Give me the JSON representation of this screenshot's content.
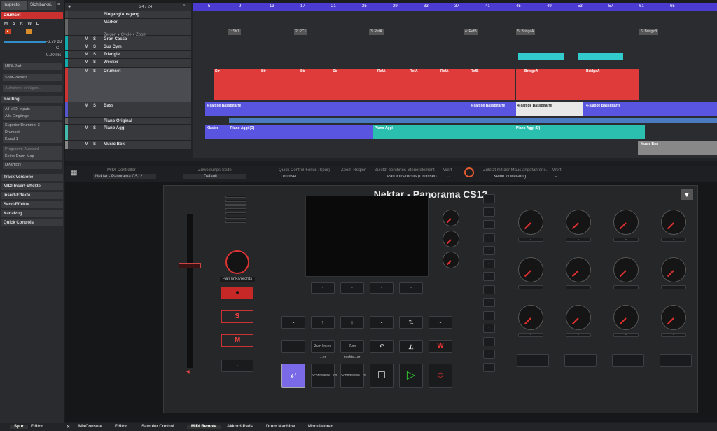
{
  "inspector": {
    "tab1": "Inspecto.",
    "tab2": "Sichtbarkei.",
    "track_name": "Drumset",
    "volume": "-6.79 dB",
    "pan": "C",
    "delay": "0.00 ms",
    "midi_part": "MIDI-Part",
    "preset": "Spur-Presets...",
    "notes": "Aufnahme einfügen...",
    "routing": "Routing",
    "input": "All MIDI Inputs",
    "input2": "Alle Eingänge",
    "instrument": "Superior Drummer 3",
    "output": "Drumset",
    "channel": "Kanal 1",
    "program": "Programm-Auswahl",
    "map": "Keine Drum-Map",
    "master": "MASTER",
    "sections": [
      "Track Versione",
      "MIDI-Insert-Effekte",
      "Insert-Effekte",
      "Send-Effekte",
      "Kanalzug",
      "Quick Controls"
    ]
  },
  "arranger": {
    "counter": "24 / 24",
    "ruler": [
      "5",
      "9",
      "13",
      "17",
      "21",
      "25",
      "29",
      "33",
      "37",
      "41",
      "45",
      "49",
      "53",
      "57",
      "61",
      "65"
    ],
    "tracks": [
      {
        "name": "Eingang/Ausgang"
      },
      {
        "name": "Marker"
      },
      {
        "name": "Gran Cassa"
      },
      {
        "name": "Sus Cym"
      },
      {
        "name": "Triangle"
      },
      {
        "name": "Wecker"
      },
      {
        "name": "Drumset"
      },
      {
        "name": "Bass"
      },
      {
        "name": "Piano Original"
      },
      {
        "name": "Piano Aggi"
      },
      {
        "name": "Music Box"
      }
    ],
    "marker_sub": [
      "Zeigen",
      "Cycle",
      "Zoom"
    ],
    "markers": [
      "1: Str1",
      "2: PC1",
      "3: RefA",
      "4: RefB",
      "5: BridgeA",
      "6: BridgeB"
    ],
    "drum_clips": [
      "Str",
      "Str",
      "Str",
      "Str",
      "RefA",
      "RefA",
      "RefA",
      "RefB",
      "BridgeA",
      "BridgeA"
    ],
    "bass_clips": [
      "4-saitige Bassgitarre",
      "4-saitige Bassgitarre",
      "4-saitige Bassgitarre",
      "4-saitige Bassgitarre"
    ],
    "piano_clips": [
      "Klavier",
      "Piano Aggi (D)",
      "Piano Aggi",
      "Piano Aggi (D)"
    ],
    "musicbox_clip": "Music Box"
  },
  "remote": {
    "controller_label": "MIDI-Controller",
    "controller": "Nektar - Panorama CS12",
    "page_label": "Zuweisungs-Seite",
    "page": "Default",
    "focus_label": "Quick Control-Fokus (Spur)",
    "focus": "Drumset",
    "zoom_label": "Zoom-Regler",
    "last_label": "Zuletzt berührtes Steuerelement",
    "last": "Pan links/rechts (Drumset)",
    "value_label": "Wert",
    "value": "C",
    "mouse_label": "Zuletzt mit der Maus angefahrene..",
    "mouse": "Keine Zuweisung",
    "value2_label": "Wert",
    "value2": "-",
    "device_title": "Nektar - Panorama CS12",
    "pan_label": "Pan links/rechts",
    "s": "S",
    "m": "M",
    "w": "W",
    "btn_zoom_left": "Zum linken ...er",
    "btn_zoom_right": "Zum rechte...er",
    "btn_step1": "Schrittweise...ds",
    "btn_step2": "Schrittweise...ts",
    "dash": "-"
  },
  "tabs": [
    "Spur",
    "Editor",
    "MixConsole",
    "Editor",
    "Sampler Control",
    "MIDI Remote",
    "Akkord-Pads",
    "Drum Machine",
    "Modulatoren"
  ]
}
